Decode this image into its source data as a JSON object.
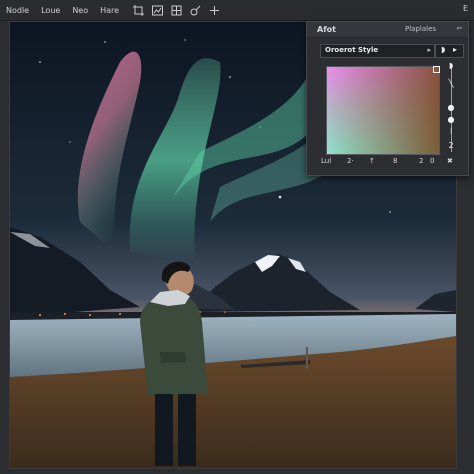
{
  "menubar": {
    "items": [
      "Nodle",
      "Loue",
      "Neo",
      "Hare"
    ],
    "tools": [
      "crop-icon",
      "chart-icon",
      "grid-icon",
      "brush-icon",
      "add-icon"
    ],
    "right_label": "E"
  },
  "panel": {
    "title": "Afot",
    "tab": "Plaplales",
    "close": "⌐",
    "style_label": "Oroerot Style",
    "style_arrow": "▸",
    "extra_left": "◗",
    "extra_right": "▸",
    "slider_labels": [
      "◗",
      "╲",
      "●",
      "●",
      "⁝",
      "2"
    ],
    "footer": {
      "label": "Lul",
      "v1": "2·",
      "arrow": "↑",
      "v2": "8",
      "v3": "2",
      "v4": "0",
      "close": "✖"
    }
  },
  "colors": {
    "aurora_green": "#5fd3a8",
    "aurora_pink": "#d870a5",
    "sky_dark": "#101827",
    "grass": "#6b4a2c"
  }
}
